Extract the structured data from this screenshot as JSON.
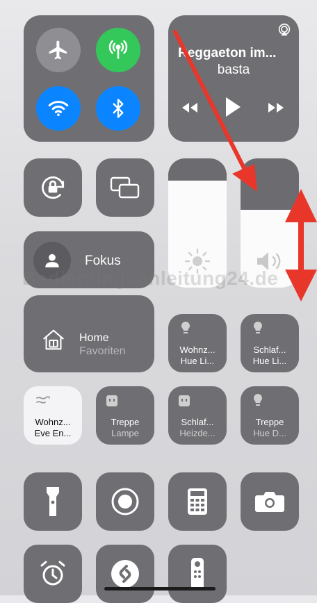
{
  "connectivity": {
    "airplane_icon": "airplane-icon",
    "cellular_icon": "cellular-antenna-icon",
    "wifi_icon": "wifi-icon",
    "bluetooth_icon": "bluetooth-icon",
    "colors": {
      "cellular_on": "#34c759",
      "wifi_on": "#0a84ff",
      "bluetooth_on": "#0a84ff",
      "airplane_off": "#8e8e93"
    }
  },
  "music": {
    "title": "Reggaeton im...",
    "subtitle": "basta",
    "airplay_icon": "airplay-icon",
    "prev_icon": "rewind-icon",
    "play_icon": "play-icon",
    "next_icon": "fast-forward-icon"
  },
  "controls": {
    "rotation_lock_icon": "rotation-lock-icon",
    "screen_mirror_icon": "screen-mirroring-icon",
    "focus_label": "Fokus",
    "focus_icon": "person-icon"
  },
  "sliders": {
    "brightness_level": 0.83,
    "volume_level": 0.6,
    "brightness_icon": "sun-icon",
    "volume_icon": "speaker-icon"
  },
  "home": {
    "title": "Home",
    "subtitle": "Favoriten",
    "icon": "home-icon"
  },
  "accessories": [
    {
      "line1": "Wohnz...",
      "line2": "Hue Li...",
      "icon": "bulb-icon",
      "active": false
    },
    {
      "line1": "Schlaf...",
      "line2": "Hue Li...",
      "icon": "bulb-icon",
      "active": false
    },
    {
      "line1": "Wohnz...",
      "line2": "Eve En...",
      "icon": "fan-icon",
      "active": true
    },
    {
      "line1": "Treppe",
      "line2": "Lampe",
      "icon": "outlet-icon",
      "active": false
    },
    {
      "line1": "Schlaf...",
      "line2": "Heizde...",
      "icon": "outlet-icon",
      "active": false
    },
    {
      "line1": "Treppe",
      "line2": "Hue D...",
      "icon": "bulb-icon",
      "active": false
    }
  ],
  "shortcuts": [
    {
      "name": "flashlight-icon"
    },
    {
      "name": "screen-record-icon"
    },
    {
      "name": "calculator-icon"
    },
    {
      "name": "camera-icon"
    },
    {
      "name": "alarm-clock-icon"
    },
    {
      "name": "shazam-icon"
    },
    {
      "name": "apple-tv-remote-icon"
    }
  ],
  "watermark": "Bedienungsanleitung24.de",
  "annotation": {
    "color": "#e8372a"
  }
}
